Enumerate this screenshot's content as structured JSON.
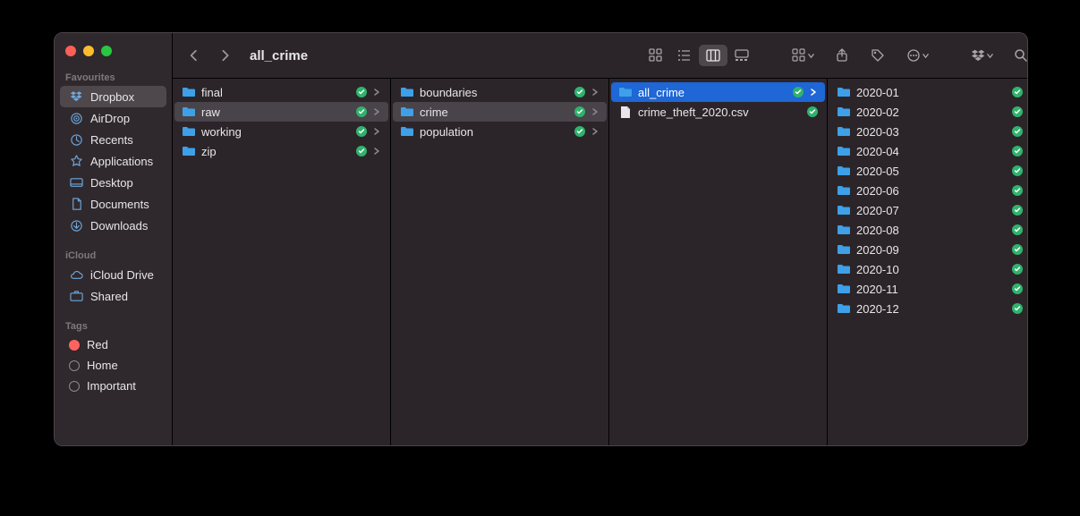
{
  "window": {
    "title": "all_crime"
  },
  "sidebar": {
    "sections": [
      {
        "label": "Favourites",
        "items": [
          {
            "icon": "dropbox",
            "label": "Dropbox",
            "selected": true
          },
          {
            "icon": "airdrop",
            "label": "AirDrop"
          },
          {
            "icon": "recents",
            "label": "Recents"
          },
          {
            "icon": "apps",
            "label": "Applications"
          },
          {
            "icon": "desktop",
            "label": "Desktop"
          },
          {
            "icon": "documents",
            "label": "Documents"
          },
          {
            "icon": "downloads",
            "label": "Downloads"
          }
        ]
      },
      {
        "label": "iCloud",
        "items": [
          {
            "icon": "icloud",
            "label": "iCloud Drive"
          },
          {
            "icon": "shared",
            "label": "Shared"
          }
        ]
      },
      {
        "label": "Tags",
        "items": [
          {
            "icon": "tag-red",
            "label": "Red"
          },
          {
            "icon": "tag-circle",
            "label": "Home"
          },
          {
            "icon": "tag-circle",
            "label": "Important"
          }
        ]
      }
    ]
  },
  "columns": [
    [
      {
        "type": "folder",
        "name": "final",
        "synced": true,
        "sel": "none"
      },
      {
        "type": "folder",
        "name": "raw",
        "synced": true,
        "sel": "path"
      },
      {
        "type": "folder",
        "name": "working",
        "synced": true,
        "sel": "none"
      },
      {
        "type": "folder",
        "name": "zip",
        "synced": true,
        "sel": "none"
      }
    ],
    [
      {
        "type": "folder",
        "name": "boundaries",
        "synced": true,
        "sel": "none"
      },
      {
        "type": "folder",
        "name": "crime",
        "synced": true,
        "sel": "path"
      },
      {
        "type": "folder",
        "name": "population",
        "synced": true,
        "sel": "none"
      }
    ],
    [
      {
        "type": "folder",
        "name": "all_crime",
        "synced": true,
        "sel": "active"
      },
      {
        "type": "file",
        "name": "crime_theft_2020.csv",
        "synced": true,
        "sel": "none"
      }
    ],
    [
      {
        "type": "folder",
        "name": "2020-01",
        "synced": true,
        "sel": "none"
      },
      {
        "type": "folder",
        "name": "2020-02",
        "synced": true,
        "sel": "none"
      },
      {
        "type": "folder",
        "name": "2020-03",
        "synced": true,
        "sel": "none"
      },
      {
        "type": "folder",
        "name": "2020-04",
        "synced": true,
        "sel": "none"
      },
      {
        "type": "folder",
        "name": "2020-05",
        "synced": true,
        "sel": "none"
      },
      {
        "type": "folder",
        "name": "2020-06",
        "synced": true,
        "sel": "none"
      },
      {
        "type": "folder",
        "name": "2020-07",
        "synced": true,
        "sel": "none"
      },
      {
        "type": "folder",
        "name": "2020-08",
        "synced": true,
        "sel": "none"
      },
      {
        "type": "folder",
        "name": "2020-09",
        "synced": true,
        "sel": "none"
      },
      {
        "type": "folder",
        "name": "2020-10",
        "synced": true,
        "sel": "none"
      },
      {
        "type": "folder",
        "name": "2020-11",
        "synced": true,
        "sel": "none"
      },
      {
        "type": "folder",
        "name": "2020-12",
        "synced": true,
        "sel": "none"
      }
    ]
  ]
}
